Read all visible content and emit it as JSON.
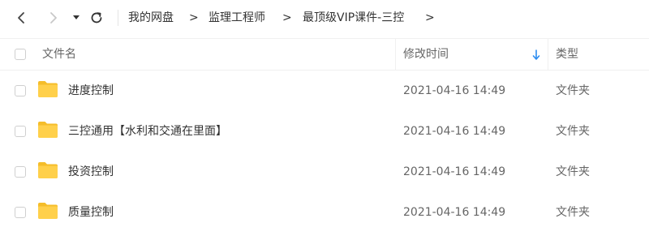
{
  "toolbar": {
    "back_icon": "chevron-left-icon",
    "forward_icon": "chevron-right-icon",
    "dropdown_icon": "caret-down-icon",
    "refresh_icon": "refresh-icon"
  },
  "breadcrumb": {
    "items": [
      "我的网盘",
      "监理工程师",
      "最顶级VIP课件-三控"
    ],
    "separator": ">"
  },
  "header": {
    "name_label": "文件名",
    "time_label": "修改时间",
    "type_label": "类型",
    "sort_icon": "arrow-down-icon",
    "sort_color": "#2b8cf0"
  },
  "files": [
    {
      "name": "进度控制",
      "modified": "2021-04-16 14:49",
      "type": "文件夹"
    },
    {
      "name": "三控通用【水利和交通在里面】",
      "modified": "2021-04-16 14:49",
      "type": "文件夹"
    },
    {
      "name": "投资控制",
      "modified": "2021-04-16 14:49",
      "type": "文件夹"
    },
    {
      "name": "质量控制",
      "modified": "2021-04-16 14:49",
      "type": "文件夹"
    }
  ],
  "colors": {
    "folder": "#ffd04b",
    "folder_dark": "#f5bd2a"
  }
}
